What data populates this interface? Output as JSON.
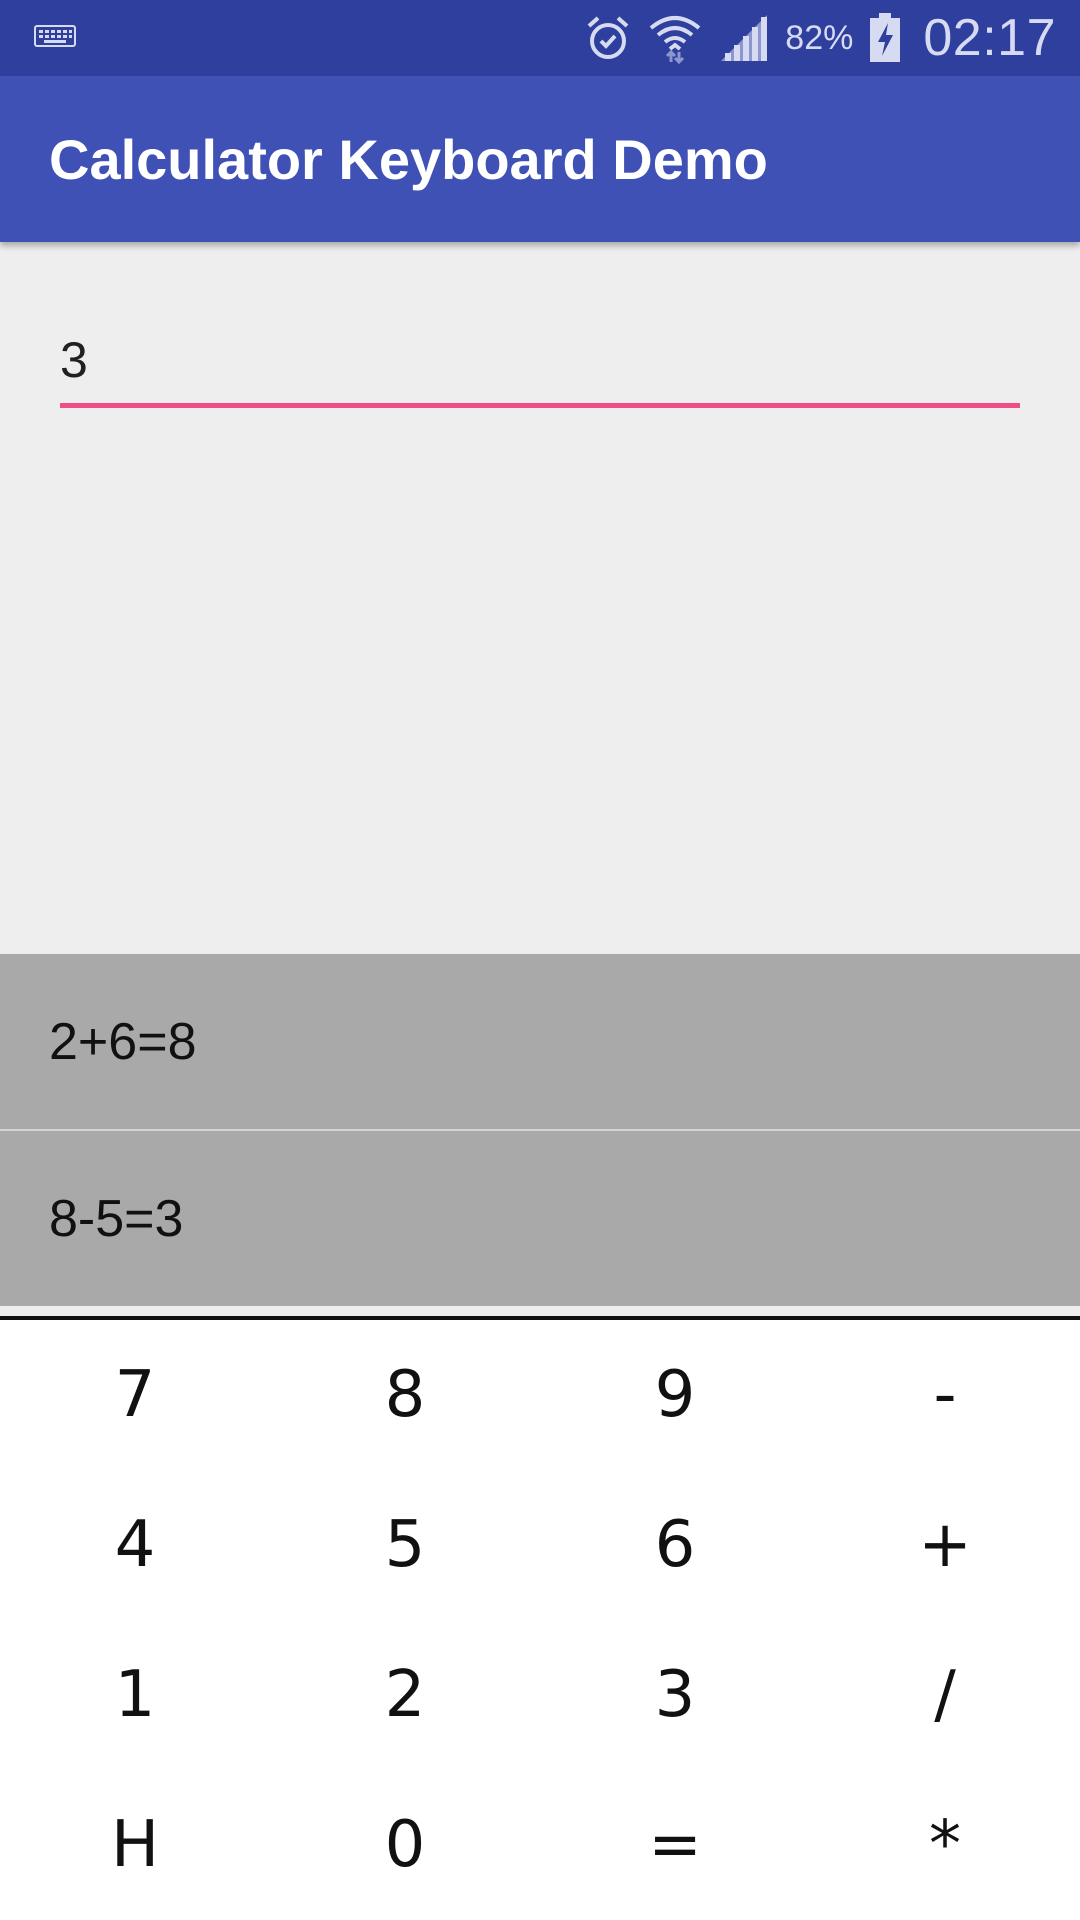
{
  "status_bar": {
    "battery_percent": "82%",
    "time": "02:17",
    "icons": [
      "keyboard-icon",
      "alarm-icon",
      "wifi-icon",
      "signal-icon",
      "battery-charging-icon"
    ]
  },
  "app_bar": {
    "title": "Calculator Keyboard Demo"
  },
  "input": {
    "value": "3"
  },
  "history": [
    {
      "text": "2+6=8"
    },
    {
      "text": "8-5=3"
    }
  ],
  "keyboard": {
    "keys": [
      "7",
      "8",
      "9",
      "-",
      "4",
      "5",
      "6",
      "+",
      "1",
      "2",
      "3",
      "/",
      "H",
      "0",
      "=",
      "*"
    ]
  },
  "colors": {
    "status_bar": "#2f3f9e",
    "app_bar": "#3f51b5",
    "accent_underline": "#ef4f88",
    "history_bg": "#a9a9a9",
    "content_bg": "#eeeeee"
  }
}
